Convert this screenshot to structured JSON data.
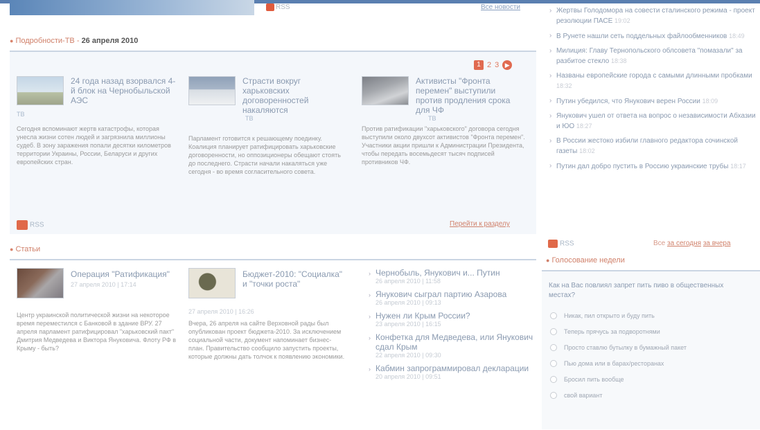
{
  "top": {
    "rss_label": "RSS",
    "link_label": "Все новости"
  },
  "tv": {
    "section_label": "Подробности-ТВ",
    "date": "26 апреля 2010",
    "pager": {
      "current": "1",
      "pages": [
        "2",
        "3"
      ]
    },
    "items": [
      {
        "title": "24 года назад взорвался 4-й блок на Чернобыльской АЭС",
        "foto": "ТВ",
        "body": "Сегодня вспоминают жертв катастрофы, которая унесла жизни сотен людей и загрязнила миллионы судеб. В зону заражения попали десятки километров территории Украины, России, Беларуси и других европейских стран."
      },
      {
        "title": "Страсти вокруг харьковских договоренностей накаляются",
        "foto": "ТВ",
        "body": "Парламент готовится к решающему поединку. Коалиция планирует ратифицировать харьковские договоренности, но оппозиционеры обещают стоять до последнего. Страсти начали накаляться уже сегодня - во время согласительного совета."
      },
      {
        "title": "Активисты \"Фронта перемен\" выступили против продления срока для ЧФ",
        "foto": "ТВ",
        "body": "Против ратификации \"харьковского\" договора сегодня выступили около двухсот активистов \"Фронта перемен\". Участники акции пришли к Администрации Президента, чтобы передать восемьдесят тысяч подписей противников ЧФ."
      }
    ],
    "rss_label": "RSS",
    "goto_section": "Перейти к разделу"
  },
  "articles": {
    "section_label": "Статьи",
    "items": [
      {
        "title": "Операция \"Ратификация\"",
        "date": "27 апреля 2010 | 17:14",
        "body": "Центр украинской политической жизни на некоторое время переместился с Банковой в здание ВРУ. 27 апреля парламент ратифицировал \"харьковский пакт\" Дмитрия Медведева и Виктора Януковича. Флоту РФ в Крыму - быть?"
      },
      {
        "title": "Бюджет-2010: \"Социалка\" и \"точки роста\"",
        "date": "27 апреля 2010 | 16:26",
        "body": "Вчера, 26 апреля на сайте Верховной рады был опубликован проект бюджета-2010. За исключением социальной части, документ напоминает бизнес-план. Правительство сообщило запустить проекты, которые должны дать толчок к появлению экономики."
      }
    ],
    "list": [
      {
        "title": "Чернобыль, Янукович и... Путин",
        "date": "26 апреля 2010 | 11:58"
      },
      {
        "title": "Янукович сыграл партию Азарова",
        "date": "26 апреля 2010 | 09:13"
      },
      {
        "title": "Нужен ли Крым России?",
        "date": "23 апреля 2010 | 16:15"
      },
      {
        "title": "Конфетка для Медведева, или Янукович сдал Крым",
        "date": "22 апреля 2010 | 09:30"
      },
      {
        "title": "Кабмин запрограммировал декларации",
        "date": "20 апреля 2010 | 09:51"
      }
    ]
  },
  "right": {
    "news": [
      {
        "title": "Жертвы Голодомора на совести сталинского режима - проект резолюции ПАСЕ",
        "time": "19:02"
      },
      {
        "title": "В Рунете нашли сеть поддельных файлообменников",
        "time": "18:49"
      },
      {
        "title": "Милиция: Главу Тернопольского облсовета \"помазали\" за разбитое стекло",
        "time": "18:38"
      },
      {
        "title": "Названы европейские города с самыми длинными пробками",
        "time": "18:32"
      },
      {
        "title": "Путин убедился, что Янукович верен России",
        "time": "18:09"
      },
      {
        "title": "Янукович ушел от ответа на вопрос о независимости Абхазии и ЮО",
        "time": "18:27"
      },
      {
        "title": "В России жестоко избили главного редактора сочинской газеты",
        "time": "18:02"
      },
      {
        "title": "Путин дал добро пустить в Россию украинские трубы",
        "time": "18:17"
      }
    ],
    "rss_label": "RSS",
    "all_label": "Все",
    "today_label": "за сегодня",
    "yesterday_label": "за вчера"
  },
  "poll": {
    "heading": "Голосование недели",
    "question": "Как на Вас повлиял запрет пить пиво в общественных местах?",
    "options": [
      "Никак, пил открыто и буду пить",
      "Теперь прячусь за подворотнями",
      "Просто ставлю бутылку в бумажный пакет",
      "Пью дома или в барах/ресторанах",
      "Бросил пить вообще",
      "свой вариант"
    ]
  }
}
